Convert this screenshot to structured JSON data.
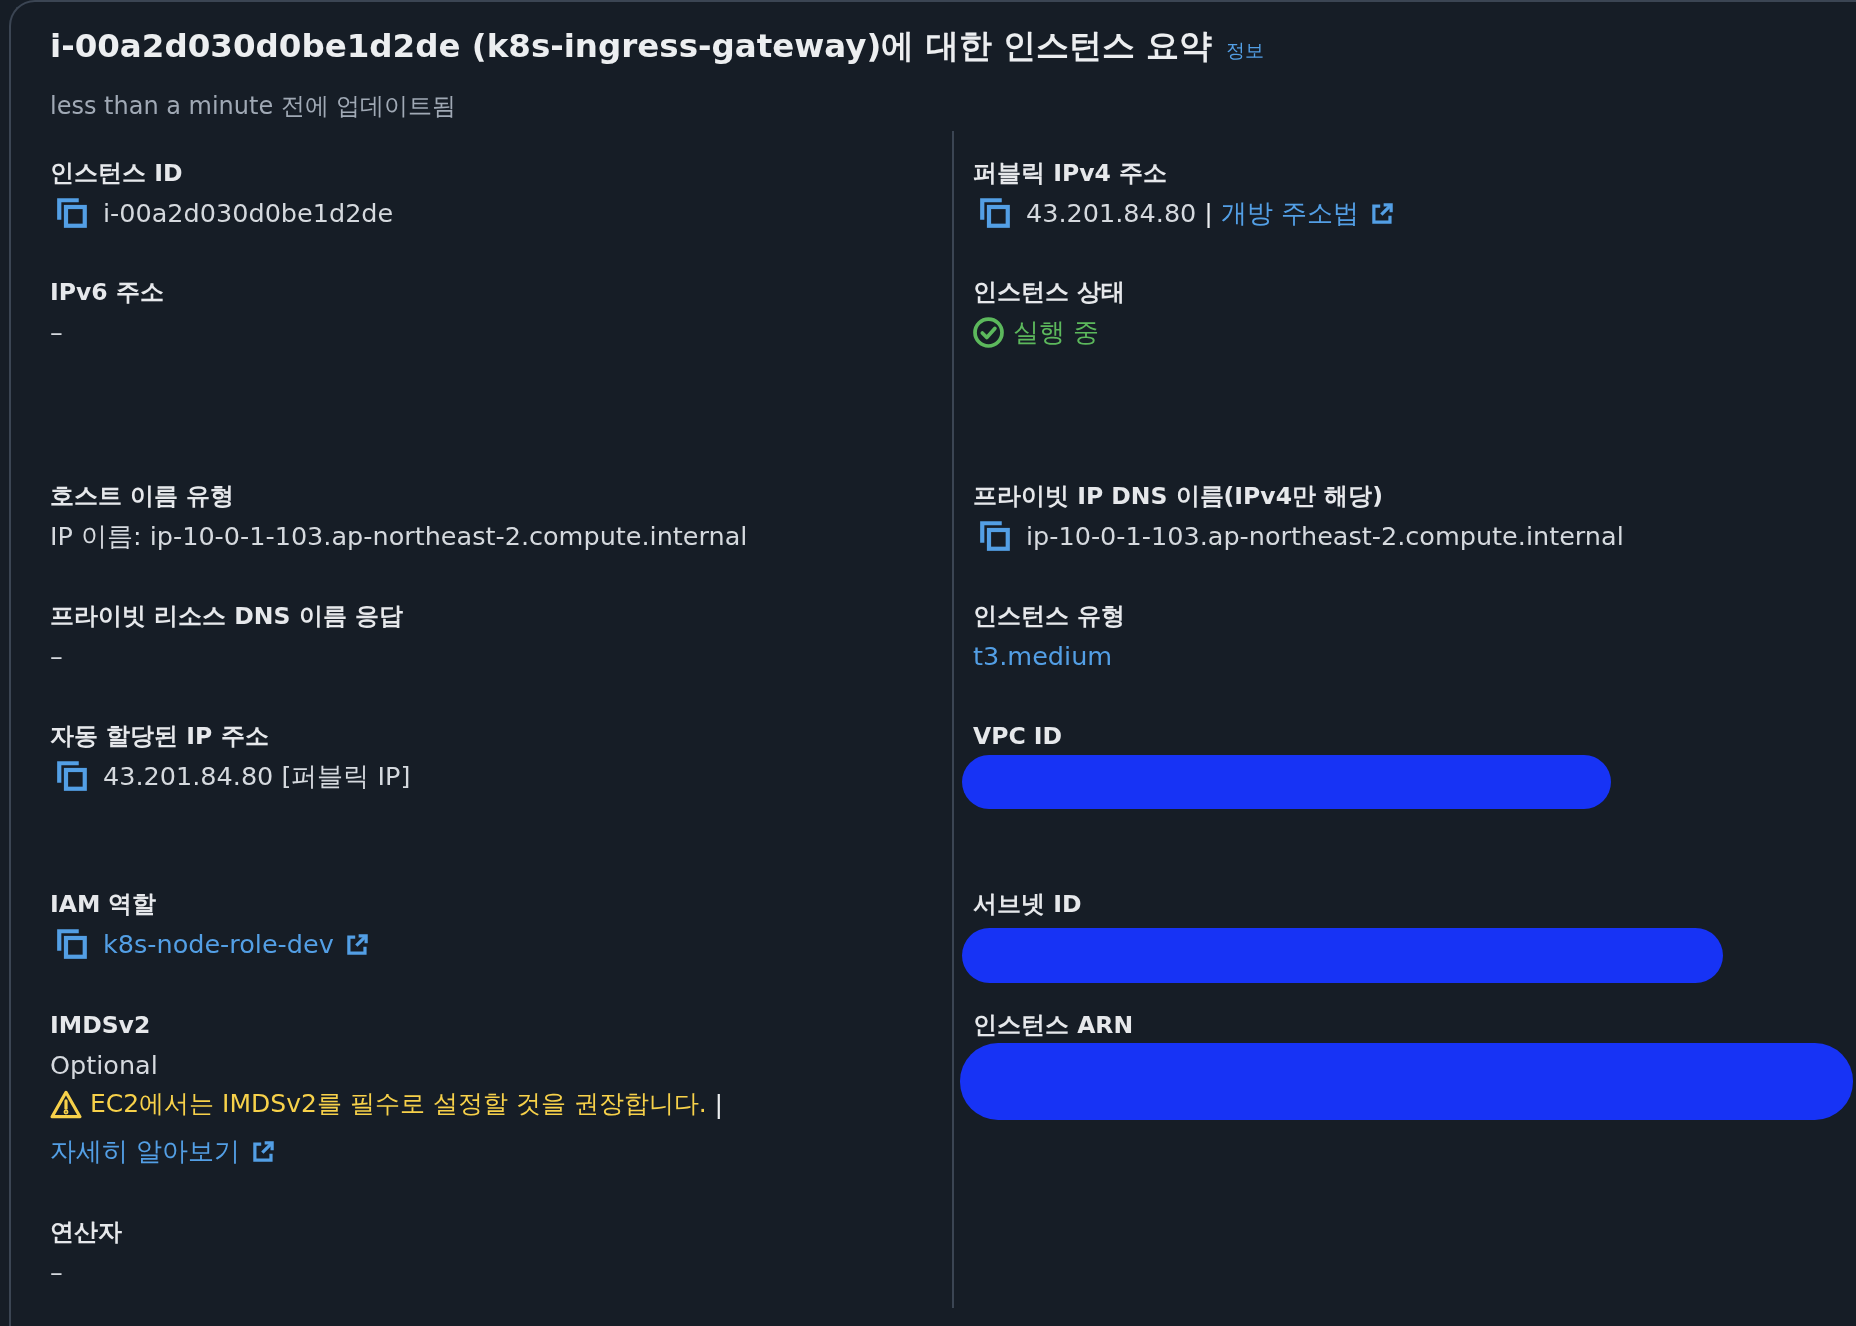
{
  "header": {
    "title": "i-00a2d030d0be1d2de (k8s-ingress-gateway)에 대한 인스턴스 요약",
    "info_link": "정보",
    "subtitle": "less than a minute 전에 업데이트됨"
  },
  "rows": [
    {
      "cells": [
        {
          "label": "인스턴스 ID",
          "kind": "copy",
          "value": "i-00a2d030d0be1d2de"
        },
        {
          "label": "퍼블릭 IPv4 주소",
          "kind": "copy",
          "value": "43.201.84.80",
          "separator": "|",
          "link": {
            "text": "개방 주소법",
            "external": true
          }
        }
      ]
    },
    {
      "cells": [
        {
          "label": "IPv6 주소",
          "kind": "text",
          "value": "–"
        },
        {
          "label": "인스턴스 상태",
          "kind": "status",
          "value": "실행 중"
        }
      ]
    },
    {
      "cells": [
        {
          "label": "호스트 이름 유형",
          "kind": "text",
          "value": "IP 이름: ip-10-0-1-103.ap-northeast-2.compute.internal"
        },
        {
          "label": "프라이빗 IP DNS 이름(IPv4만 해당)",
          "kind": "copy",
          "value": "ip-10-0-1-103.ap-northeast-2.compute.internal"
        }
      ]
    },
    {
      "cells": [
        {
          "label": "프라이빗 리소스 DNS 이름 응답",
          "kind": "text",
          "value": "–"
        },
        {
          "label": "인스턴스 유형",
          "kind": "link",
          "link": {
            "text": "t3.medium",
            "external": false
          }
        }
      ]
    },
    {
      "cells": [
        {
          "label": "자동 할당된 IP 주소",
          "kind": "copy",
          "value": "43.201.84.80 [퍼블릭 IP]"
        },
        {
          "label": "VPC ID",
          "kind": "redacted"
        }
      ]
    },
    {
      "cells": [
        {
          "label": "IAM 역할",
          "kind": "copy",
          "link": {
            "text": "k8s-node-role-dev",
            "external": true
          }
        },
        {
          "label": "서브넷 ID",
          "kind": "redacted"
        }
      ]
    },
    {
      "cells": [
        {
          "label": "IMDSv2",
          "kind": "text",
          "value": "Optional",
          "warning": {
            "text": "EC2에서는 IMDSv2를 필수로 설정할 것을 권장합니다.",
            "separator": "|"
          },
          "link": {
            "text": "자세히 알아보기",
            "external": true
          }
        },
        {
          "label": "인스턴스 ARN",
          "kind": "redacted"
        }
      ]
    },
    {
      "cells": [
        {
          "label": "연산자",
          "kind": "text",
          "value": "–"
        }
      ]
    }
  ]
}
